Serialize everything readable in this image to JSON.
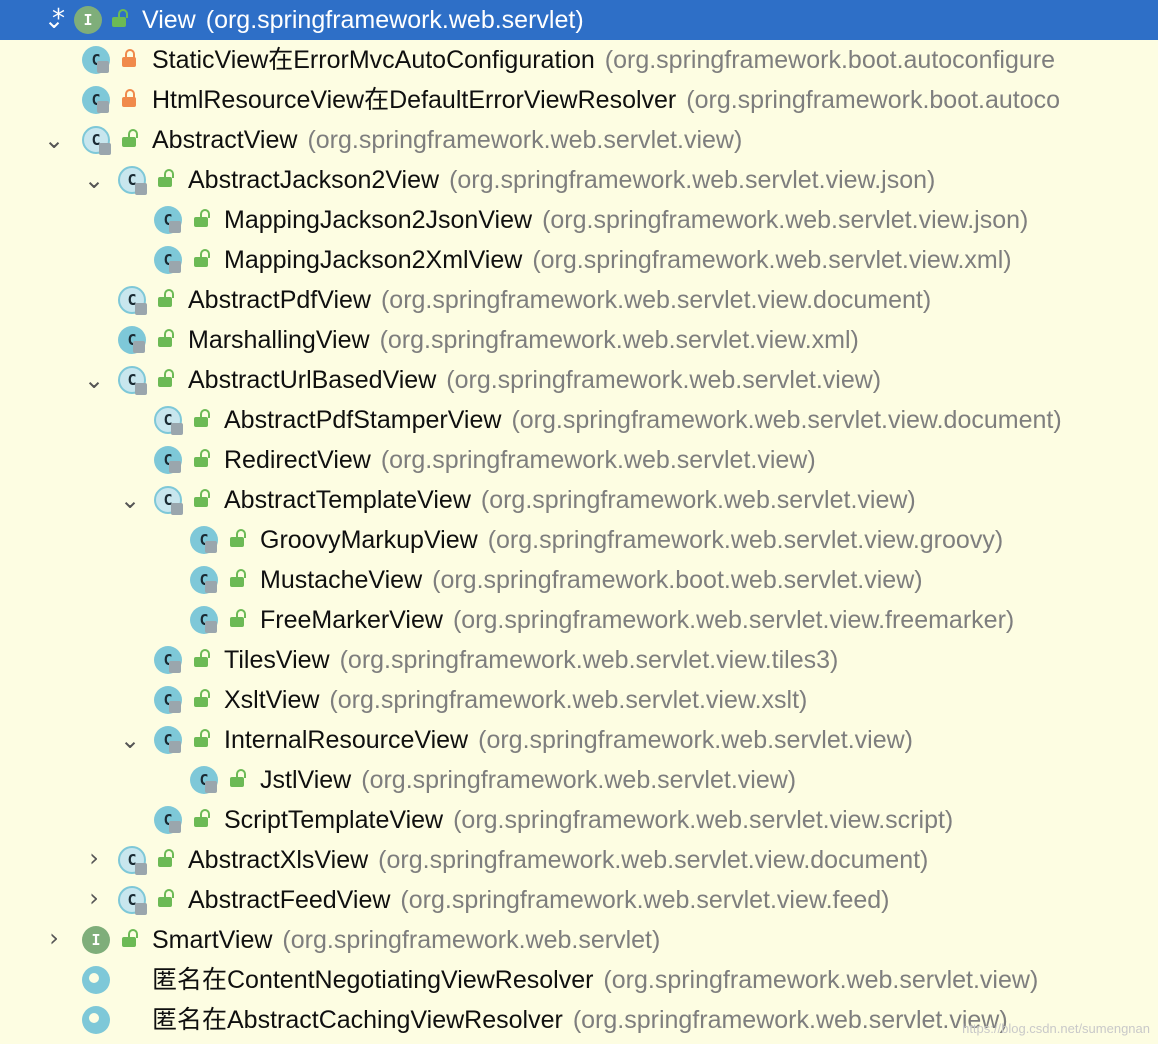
{
  "tree": [
    {
      "name": "View",
      "package": "(org.springframework.web.servlet)",
      "kind": "interface",
      "visibility": "public",
      "expand": "expanded",
      "level": 0,
      "selected": true,
      "marker": "*"
    },
    {
      "name": "StaticView在ErrorMvcAutoConfiguration",
      "package": "(org.springframework.boot.autoconfigure",
      "kind": "class",
      "visibility": "private",
      "expand": "none",
      "level": 0
    },
    {
      "name": "HtmlResourceView在DefaultErrorViewResolver",
      "package": "(org.springframework.boot.autoco",
      "kind": "class",
      "visibility": "private",
      "expand": "none",
      "level": 0
    },
    {
      "name": "AbstractView",
      "package": "(org.springframework.web.servlet.view)",
      "kind": "abstract",
      "visibility": "public",
      "expand": "expanded",
      "level": 0
    },
    {
      "name": "AbstractJackson2View",
      "package": "(org.springframework.web.servlet.view.json)",
      "kind": "abstract",
      "visibility": "public",
      "expand": "expanded",
      "level": 1
    },
    {
      "name": "MappingJackson2JsonView",
      "package": "(org.springframework.web.servlet.view.json)",
      "kind": "class",
      "visibility": "public",
      "expand": "none",
      "level": 2
    },
    {
      "name": "MappingJackson2XmlView",
      "package": "(org.springframework.web.servlet.view.xml)",
      "kind": "class",
      "visibility": "public",
      "expand": "none",
      "level": 2
    },
    {
      "name": "AbstractPdfView",
      "package": "(org.springframework.web.servlet.view.document)",
      "kind": "abstract",
      "visibility": "public",
      "expand": "none",
      "level": 1
    },
    {
      "name": "MarshallingView",
      "package": "(org.springframework.web.servlet.view.xml)",
      "kind": "class",
      "visibility": "public",
      "expand": "none",
      "level": 1
    },
    {
      "name": "AbstractUrlBasedView",
      "package": "(org.springframework.web.servlet.view)",
      "kind": "abstract",
      "visibility": "public",
      "expand": "expanded",
      "level": 1
    },
    {
      "name": "AbstractPdfStamperView",
      "package": "(org.springframework.web.servlet.view.document)",
      "kind": "abstract",
      "visibility": "public",
      "expand": "none",
      "level": 2
    },
    {
      "name": "RedirectView",
      "package": "(org.springframework.web.servlet.view)",
      "kind": "class",
      "visibility": "public",
      "expand": "none",
      "level": 2
    },
    {
      "name": "AbstractTemplateView",
      "package": "(org.springframework.web.servlet.view)",
      "kind": "abstract",
      "visibility": "public",
      "expand": "expanded",
      "level": 2
    },
    {
      "name": "GroovyMarkupView",
      "package": "(org.springframework.web.servlet.view.groovy)",
      "kind": "class",
      "visibility": "public",
      "expand": "none",
      "level": 3
    },
    {
      "name": "MustacheView",
      "package": "(org.springframework.boot.web.servlet.view)",
      "kind": "class",
      "visibility": "public",
      "expand": "none",
      "level": 3
    },
    {
      "name": "FreeMarkerView",
      "package": "(org.springframework.web.servlet.view.freemarker)",
      "kind": "class",
      "visibility": "public",
      "expand": "none",
      "level": 3
    },
    {
      "name": "TilesView",
      "package": "(org.springframework.web.servlet.view.tiles3)",
      "kind": "class",
      "visibility": "public",
      "expand": "none",
      "level": 2
    },
    {
      "name": "XsltView",
      "package": "(org.springframework.web.servlet.view.xslt)",
      "kind": "class",
      "visibility": "public",
      "expand": "none",
      "level": 2
    },
    {
      "name": "InternalResourceView",
      "package": "(org.springframework.web.servlet.view)",
      "kind": "class",
      "visibility": "public",
      "expand": "expanded",
      "level": 2
    },
    {
      "name": "JstlView",
      "package": "(org.springframework.web.servlet.view)",
      "kind": "class",
      "visibility": "public",
      "expand": "none",
      "level": 3
    },
    {
      "name": "ScriptTemplateView",
      "package": "(org.springframework.web.servlet.view.script)",
      "kind": "class",
      "visibility": "public",
      "expand": "none",
      "level": 2
    },
    {
      "name": "AbstractXlsView",
      "package": "(org.springframework.web.servlet.view.document)",
      "kind": "abstract",
      "visibility": "public",
      "expand": "collapsed",
      "level": 1
    },
    {
      "name": "AbstractFeedView",
      "package": "(org.springframework.web.servlet.view.feed)",
      "kind": "abstract",
      "visibility": "public",
      "expand": "collapsed",
      "level": 1
    },
    {
      "name": "SmartView",
      "package": "(org.springframework.web.servlet)",
      "kind": "interface",
      "visibility": "public",
      "expand": "collapsed",
      "level": 0
    },
    {
      "name": "匿名在ContentNegotiatingViewResolver",
      "package": "(org.springframework.web.servlet.view)",
      "kind": "anon",
      "visibility": "none",
      "expand": "none",
      "level": 0
    },
    {
      "name": "匿名在AbstractCachingViewResolver",
      "package": "(org.springframework.web.servlet.view)",
      "kind": "anon",
      "visibility": "none",
      "expand": "none",
      "level": 0
    }
  ],
  "watermark": "https://blog.csdn.net/sumengnan",
  "colors": {
    "selection": "#2e6fc7",
    "background": "#fdfde2",
    "class_icon": "#7ec8d8",
    "interface_icon": "#7fae7a",
    "public_lock": "#6cba55",
    "private_lock": "#f08a4b"
  }
}
